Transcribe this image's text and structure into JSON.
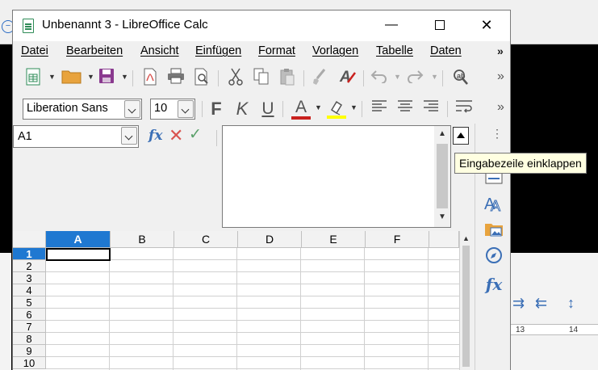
{
  "window": {
    "title": "Unbenannt 3 - LibreOffice Calc",
    "minimize_glyph": "—",
    "close_glyph": "✕"
  },
  "menu": {
    "items": [
      "Datei",
      "Bearbeiten",
      "Ansicht",
      "Einfügen",
      "Format",
      "Vorlagen",
      "Tabelle",
      "Daten"
    ],
    "more": "»"
  },
  "toolbar_standard": {
    "more": "»"
  },
  "toolbar_format": {
    "font_name": "Liberation Sans",
    "font_size": "10",
    "bold": "F",
    "italic": "K",
    "underline": "U",
    "font_color_letter": "A",
    "more": "»",
    "colors": {
      "font_color": "#c9211e",
      "highlight_color": "#ffff00"
    }
  },
  "formula_bar": {
    "name_box": "A1",
    "fx_label": "fx",
    "input_value": ""
  },
  "sidebar": {
    "dots": "⋮"
  },
  "tooltip": {
    "text": "Eingabezeile einklappen"
  },
  "grid": {
    "columns": [
      "A",
      "B",
      "C",
      "D",
      "E",
      "F"
    ],
    "rows": [
      "1",
      "2",
      "3",
      "4",
      "5",
      "6",
      "7",
      "8",
      "9",
      "10"
    ],
    "selected_cell": "A1"
  },
  "background_ruler": {
    "ticks": [
      "13",
      "14"
    ]
  },
  "colors": {
    "selection_blue": "#1f78d1",
    "icon_blue": "#3b6fb6"
  }
}
